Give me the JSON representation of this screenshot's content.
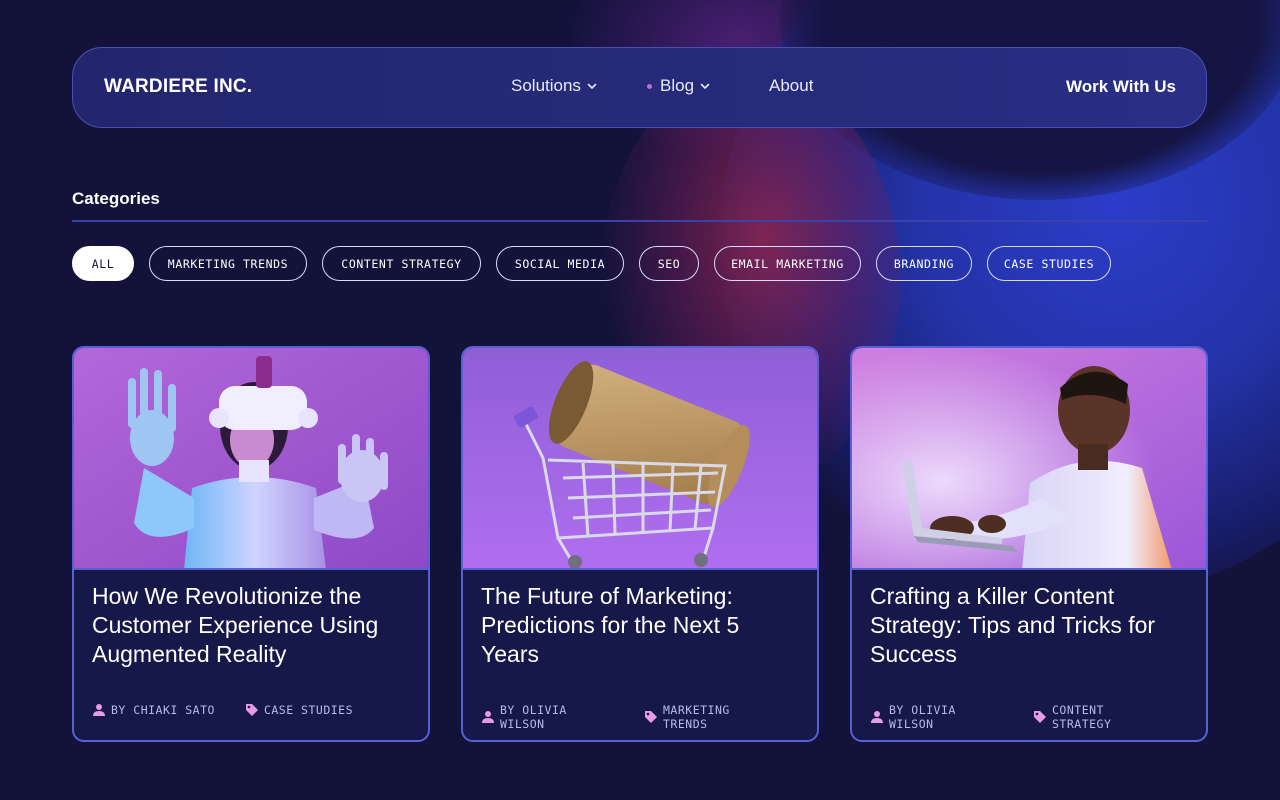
{
  "brand": "WARDIERE INC.",
  "nav": {
    "items": [
      {
        "label": "Solutions",
        "has_dropdown": true,
        "active": false
      },
      {
        "label": "Blog",
        "has_dropdown": true,
        "active": true
      },
      {
        "label": "About",
        "has_dropdown": false,
        "active": false
      }
    ],
    "cta_label": "Work With Us"
  },
  "categories": {
    "title": "Categories",
    "chips": [
      {
        "label": "ALL",
        "active": true
      },
      {
        "label": "MARKETING TRENDS",
        "active": false
      },
      {
        "label": "CONTENT STRATEGY",
        "active": false
      },
      {
        "label": "SOCIAL MEDIA",
        "active": false
      },
      {
        "label": "SEO",
        "active": false
      },
      {
        "label": "EMAIL MARKETING",
        "active": false
      },
      {
        "label": "BRANDING",
        "active": false
      },
      {
        "label": "CASE STUDIES",
        "active": false
      }
    ]
  },
  "posts": [
    {
      "image": "person-vr-headset-photo",
      "title": "How We Revolutionize the Customer Experience Using Augmented Reality",
      "author": "BY CHIAKI SATO",
      "category": "CASE STUDIES"
    },
    {
      "image": "shopping-cart-cardboard-tube-photo",
      "title": "The Future of Marketing: Predictions for the Next 5 Years",
      "author": "BY OLIVIA WILSON",
      "category": "MARKETING TRENDS"
    },
    {
      "image": "man-using-laptop-photo",
      "title": "Crafting a Killer Content Strategy: Tips and Tricks for Success",
      "author": "BY OLIVIA WILSON",
      "category": "CONTENT STRATEGY"
    }
  ],
  "colors": {
    "background": "#12123a",
    "accent_border": "#5761d6",
    "meta_icon": "#e69ae8",
    "nav_dot": "#c36bd6"
  }
}
